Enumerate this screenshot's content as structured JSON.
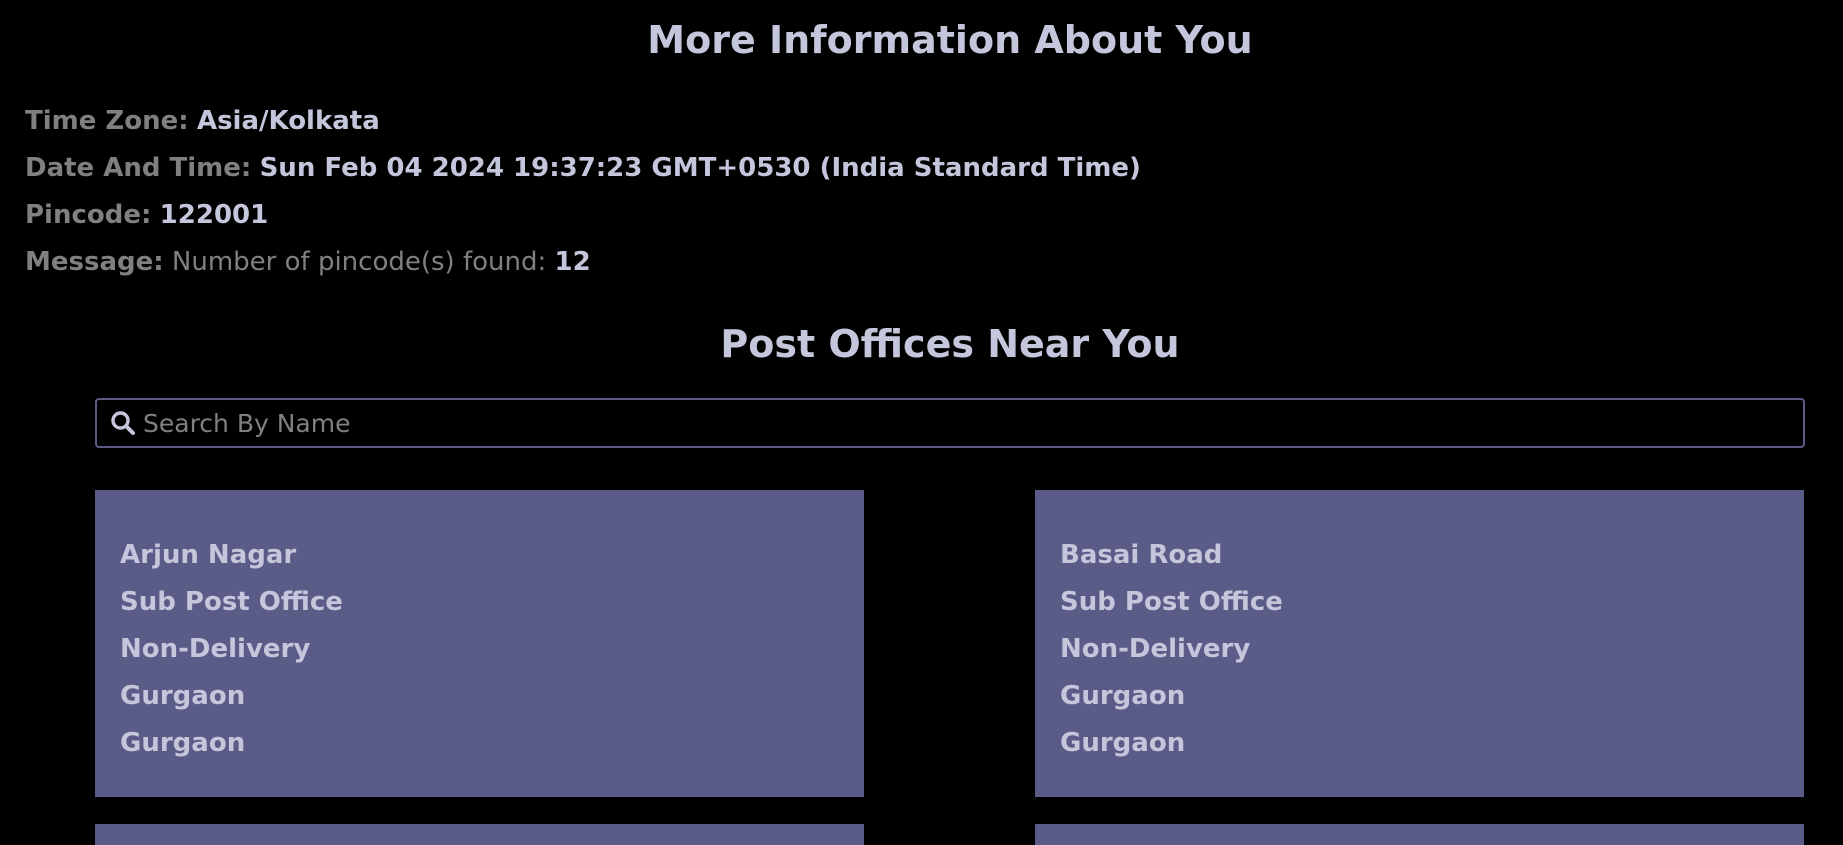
{
  "header": {
    "title": "More Information About You"
  },
  "info": {
    "timezone_label": "Time Zone:",
    "timezone_value": "Asia/Kolkata",
    "datetime_label": "Date And Time:",
    "datetime_value": "Sun Feb 04 2024 19:37:23 GMT+0530 (India Standard Time)",
    "pincode_label": "Pincode:",
    "pincode_value": "122001",
    "message_label": "Message:",
    "message_text": "Number of pincode(s) found:",
    "message_count": "12"
  },
  "post_offices": {
    "title": "Post Offices Near You",
    "search_placeholder": "Search By Name",
    "search_value": "",
    "cards": [
      {
        "name": "Arjun Nagar",
        "branch_type": "Sub Post Office",
        "delivery_status": "Non-Delivery",
        "district": "Gurgaon",
        "division": "Gurgaon"
      },
      {
        "name": "Basai Road",
        "branch_type": "Sub Post Office",
        "delivery_status": "Non-Delivery",
        "district": "Gurgaon",
        "division": "Gurgaon"
      }
    ]
  },
  "colors": {
    "background": "#000000",
    "card": "#5b5b87",
    "heading": "#c4c6dc",
    "muted": "#808080"
  }
}
